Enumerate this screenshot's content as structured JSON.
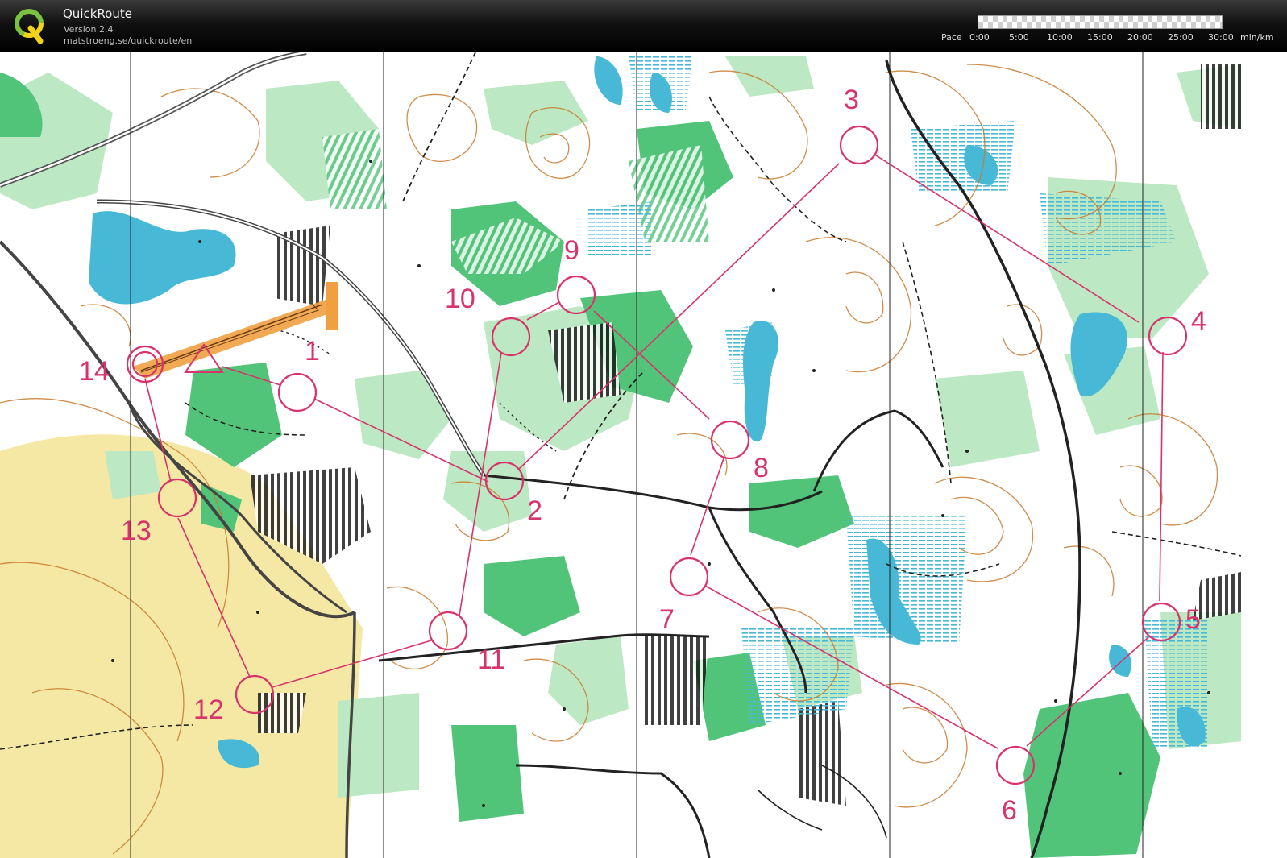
{
  "app": {
    "title": "QuickRoute",
    "version": "Version 2.4",
    "url": "matstroeng.se/quickroute/en"
  },
  "pace_scale": {
    "label": "Pace",
    "ticks": [
      "0:00",
      "5:00",
      "10:00",
      "15:00",
      "20:00",
      "25:00",
      "30:00"
    ],
    "unit": "min/km"
  },
  "course": {
    "color": "#d8336b",
    "controls": [
      {
        "label": "1"
      },
      {
        "label": "2"
      },
      {
        "label": "3"
      },
      {
        "label": "4"
      },
      {
        "label": "5"
      },
      {
        "label": "6"
      },
      {
        "label": "7"
      },
      {
        "label": "8"
      },
      {
        "label": "9"
      },
      {
        "label": "10"
      },
      {
        "label": "11"
      },
      {
        "label": "12"
      },
      {
        "label": "13"
      },
      {
        "label": "14"
      }
    ]
  },
  "map_colors": {
    "green": "#52c47a",
    "light_green": "#bde8c4",
    "yellow": "#f4e8a4",
    "water": "#47b9d6",
    "contour": "#c8792c",
    "track": "#f0a040"
  }
}
